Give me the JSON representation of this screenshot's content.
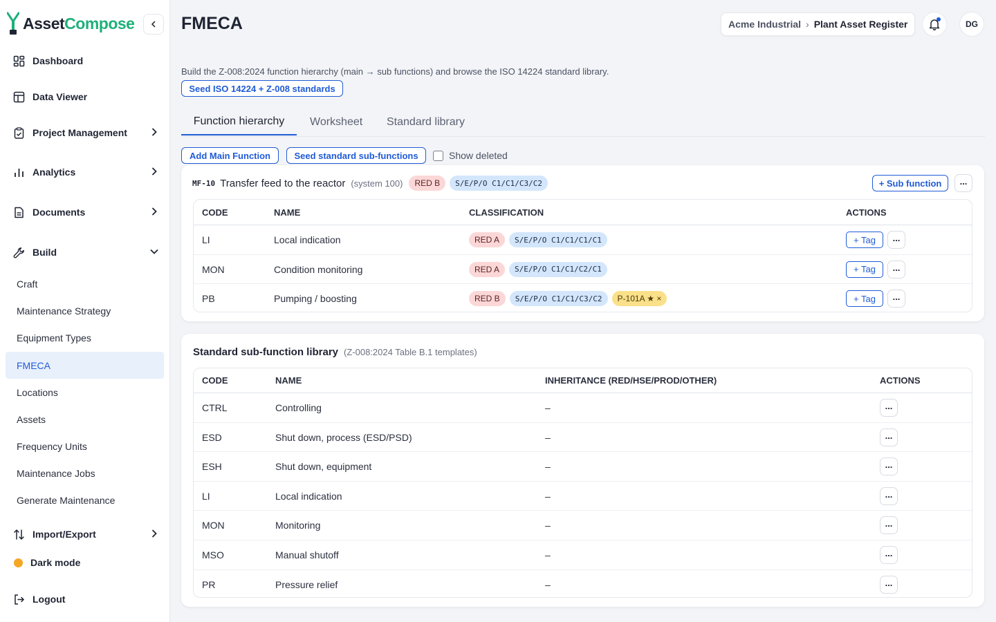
{
  "app": {
    "brand_left": "Asset",
    "brand_right": "Compose",
    "colors": {
      "accent": "#1f5bd6",
      "brand_green": "#1fb07a",
      "red_chip": "#fbd7d7",
      "blue_chip": "#d3e6fb",
      "yellow_chip": "#fbe08a"
    }
  },
  "sidebar": {
    "main_items": [
      {
        "label": "Dashboard",
        "icon": "dashboard-icon"
      },
      {
        "label": "Data Viewer",
        "icon": "table-icon"
      },
      {
        "label": "Project Management",
        "icon": "clipboard-icon"
      },
      {
        "label": "Analytics",
        "icon": "bar-chart-icon"
      },
      {
        "label": "Documents",
        "icon": "document-icon"
      },
      {
        "label": "Build",
        "icon": "wrench-icon"
      }
    ],
    "build_items": [
      "Craft",
      "Maintenance Strategy",
      "Equipment Types",
      "FMECA",
      "Locations",
      "Assets",
      "Frequency Units",
      "Maintenance Jobs",
      "Generate Maintenance"
    ],
    "import_export": "Import/Export",
    "dark_mode": "Dark mode",
    "logout": "Logout"
  },
  "header": {
    "title": "FMECA",
    "breadcrumb_org": "Acme Industrial",
    "breadcrumb_sep": "›",
    "breadcrumb_register": "Plant Asset Register",
    "avatar_initials": "DG"
  },
  "main": {
    "description": "Build the Z-008:2024 function hierarchy (main → sub functions) and browse the ISO 14224 standard library.",
    "seed_button": "Seed ISO 14224 + Z-008 standards",
    "tabs": [
      "Function hierarchy",
      "Worksheet",
      "Standard library"
    ],
    "add_main_function": "Add Main Function",
    "seed_sub_functions": "Seed standard sub-functions",
    "show_deleted": "Show deleted"
  },
  "main_function": {
    "code": "MF-10",
    "name": "Transfer feed to the reactor",
    "system": "(system 100)",
    "red_chip": "RED B",
    "class_chip": "S/E/P/O C1/C1/C3/C2",
    "sub_function_button": "+ Sub function",
    "more": "...",
    "columns": [
      "CODE",
      "NAME",
      "CLASSIFICATION",
      "ACTIONS"
    ],
    "rows": [
      {
        "code": "LI",
        "name": "Local indication",
        "red": "RED A",
        "cls": "S/E/P/O C1/C1/C1/C1",
        "tag": "",
        "action": "+ Tag",
        "more": "..."
      },
      {
        "code": "MON",
        "name": "Condition monitoring",
        "red": "RED A",
        "cls": "S/E/P/O C1/C1/C2/C1",
        "tag": "",
        "action": "+ Tag",
        "more": "..."
      },
      {
        "code": "PB",
        "name": "Pumping / boosting",
        "red": "RED B",
        "cls": "S/E/P/O C1/C1/C3/C2",
        "tag": "P-101A ★ ×",
        "action": "+ Tag",
        "more": "..."
      }
    ]
  },
  "library": {
    "title": "Standard sub-function library",
    "subtitle": "(Z-008:2024 Table B.1 templates)",
    "columns": [
      "CODE",
      "NAME",
      "INHERITANCE (RED/HSE/PROD/OTHER)",
      "ACTIONS"
    ],
    "rows": [
      {
        "code": "CTRL",
        "name": "Controlling",
        "inheritance": "–",
        "more": "..."
      },
      {
        "code": "ESD",
        "name": "Shut down, process (ESD/PSD)",
        "inheritance": "–",
        "more": "..."
      },
      {
        "code": "ESH",
        "name": "Shut down, equipment",
        "inheritance": "–",
        "more": "..."
      },
      {
        "code": "LI",
        "name": "Local indication",
        "inheritance": "–",
        "more": "..."
      },
      {
        "code": "MON",
        "name": "Monitoring",
        "inheritance": "–",
        "more": "..."
      },
      {
        "code": "MSO",
        "name": "Manual shutoff",
        "inheritance": "–",
        "more": "..."
      },
      {
        "code": "PR",
        "name": "Pressure relief",
        "inheritance": "–",
        "more": "..."
      }
    ]
  }
}
